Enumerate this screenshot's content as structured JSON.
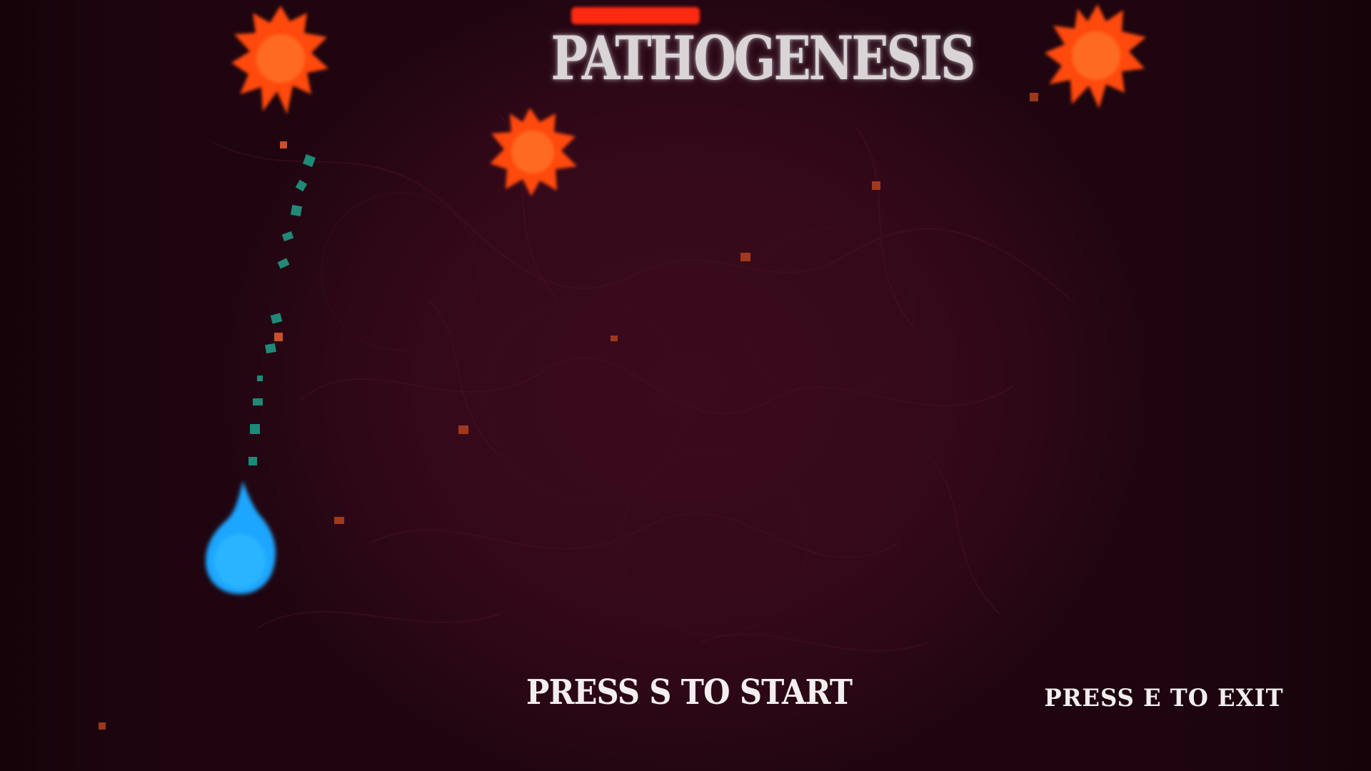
{
  "game": {
    "title": "PATHOGENESIS",
    "start_prompt": "PRESS S TO START",
    "exit_prompt": "PRESS E TO EXIT"
  },
  "entities": {
    "player": "blue-cell",
    "enemies": [
      "virus",
      "virus",
      "virus"
    ],
    "trail": "green-particles",
    "debris": "orange-particles"
  },
  "colors": {
    "background": "#34091a",
    "virus": "#ff4a10",
    "player": "#1ea6ff",
    "trail": "#1f8a78",
    "title_bar": "#ff2a12",
    "text": "#f2eef0"
  }
}
